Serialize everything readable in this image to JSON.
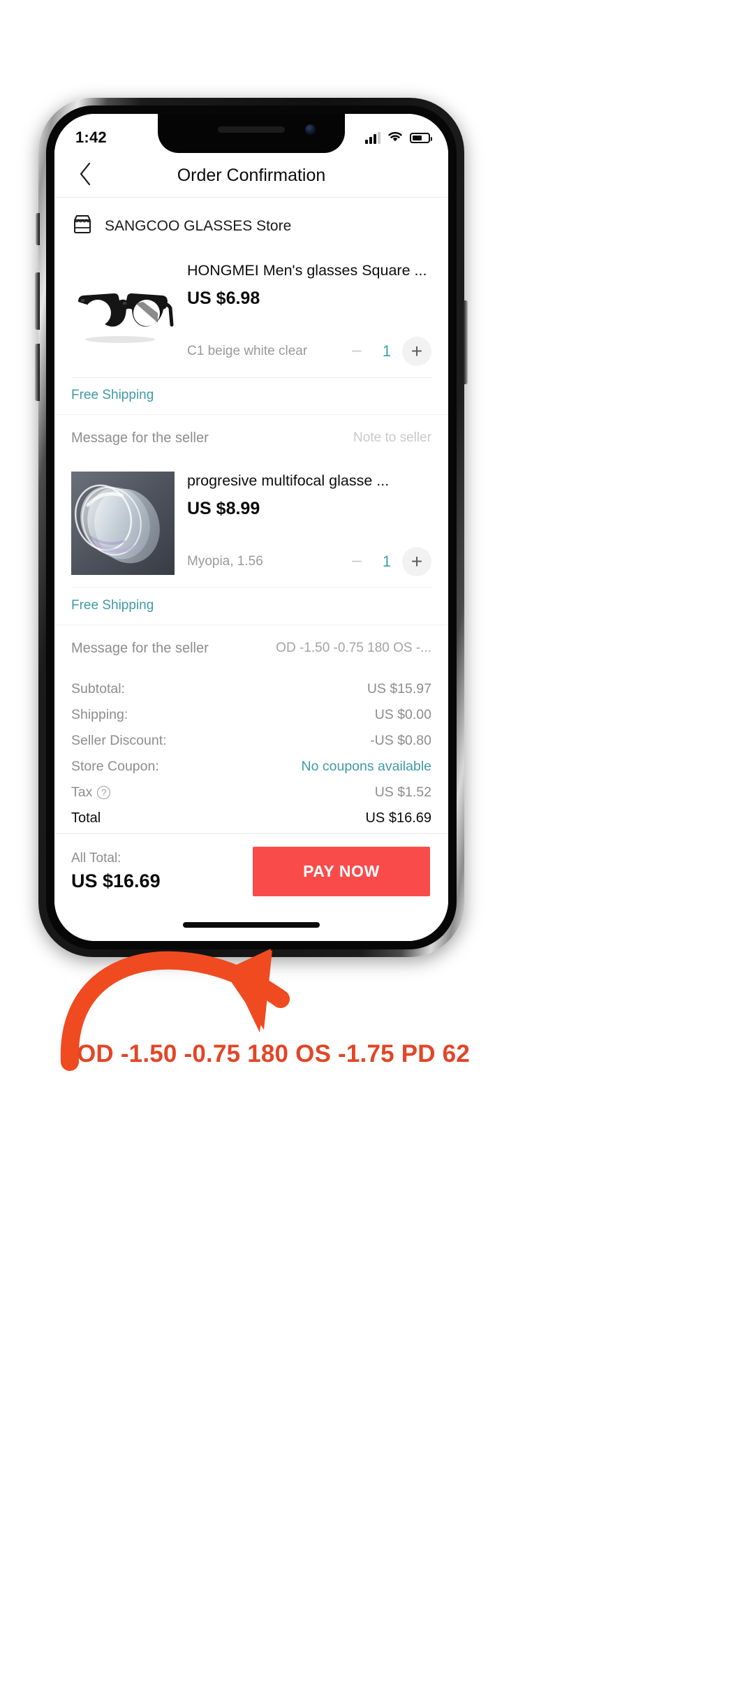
{
  "status_bar": {
    "time": "1:42",
    "signal_icon": "signal-bars-icon",
    "wifi_icon": "wifi-icon",
    "battery_icon": "battery-icon"
  },
  "header": {
    "back_icon": "chevron-left-icon",
    "title": "Order Confirmation"
  },
  "store": {
    "icon": "storefront-icon",
    "name": "SANGCOO GLASSES Store"
  },
  "products": [
    {
      "image_alt": "black-square-eyeglasses",
      "title": "HONGMEI Men's glasses Square ...",
      "price": "US $6.98",
      "variant": "C1 beige white clear",
      "minus_label": "−",
      "quantity": "1",
      "plus_label": "+",
      "shipping": "Free Shipping",
      "message_label": "Message for the seller",
      "message_value": "Note to seller",
      "message_is_placeholder": true
    },
    {
      "image_alt": "stacked-clear-lenses",
      "title": "progresive multifocal glasse ...",
      "price": "US $8.99",
      "variant": "Myopia, 1.56",
      "minus_label": "−",
      "quantity": "1",
      "plus_label": "+",
      "shipping": "Free Shipping",
      "message_label": "Message for the seller",
      "message_value": "OD -1.50 -0.75 180 OS -...",
      "message_is_placeholder": false
    }
  ],
  "summary": {
    "rows": [
      {
        "label": "Subtotal:",
        "value": "US $15.97",
        "value_style": "grey"
      },
      {
        "label": "Shipping:",
        "value": "US $0.00",
        "value_style": "grey"
      },
      {
        "label": "Seller Discount:",
        "value": "-US $0.80",
        "value_style": "grey"
      },
      {
        "label": "Store Coupon:",
        "value": "No coupons available",
        "value_style": "teal"
      },
      {
        "label": "Tax",
        "value": "US $1.52",
        "value_style": "grey",
        "help_icon": "question-mark-icon"
      },
      {
        "label": "Total",
        "value": "US $16.69",
        "value_style": "bold"
      }
    ]
  },
  "pay_bar": {
    "all_total_label": "All Total:",
    "all_total_value": "US $16.69",
    "pay_button_label": "PAY NOW"
  },
  "annotation": {
    "arrow_icon": "curved-arrow-icon",
    "text": "OD -1.50 -0.75 180 OS -1.75 PD 62",
    "color": "#e34526"
  },
  "colors": {
    "accent_teal": "#3f9aa8",
    "pay_red": "#fa4b4b",
    "annotation_orange": "#e34526"
  }
}
